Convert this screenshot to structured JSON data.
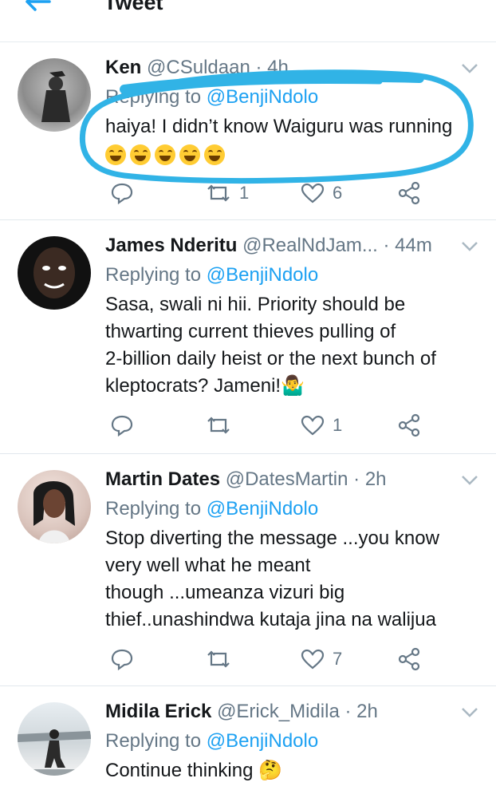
{
  "header": {
    "title": "Tweet"
  },
  "tweets": [
    {
      "name": "Ken",
      "handle": "@CSuldaan",
      "time": "4h",
      "reply_prefix": "Replying to",
      "reply_to": "@BenjiNdolo",
      "text": "haiya! I didn’t know Waiguru was running",
      "emoji": "😂😂😂😂😂",
      "retweets": "1",
      "likes": "6"
    },
    {
      "name": "James Nderitu",
      "handle": "@RealNdJam...",
      "time": "44m",
      "reply_prefix": "Replying to",
      "reply_to": "@BenjiNdolo",
      "text_lines": [
        "Sasa, swali ni hii. Priority should be",
        "thwarting current thieves pulling of",
        "2-billion daily heist or the next bunch of",
        "kleptocrats? Jameni!🤷‍♂️"
      ],
      "retweets": "",
      "likes": "1"
    },
    {
      "name": "Martin Dates",
      "handle": "@DatesMartin",
      "time": "2h",
      "reply_prefix": "Replying to",
      "reply_to": "@BenjiNdolo",
      "text_lines": [
        "Stop diverting the message ...you know",
        "very well what he meant",
        "though ...umeanza vizuri big",
        "thief..unashindwa kutaja jina na walijua"
      ],
      "retweets": "",
      "likes": "7"
    },
    {
      "name": "Midila Erick",
      "handle": "@Erick_Midila",
      "time": "2h",
      "reply_prefix": "Replying to",
      "reply_to": "@BenjiNdolo",
      "text": "Continue thinking 🤔"
    }
  ],
  "colors": {
    "link": "#1da1f2",
    "muted": "#657786",
    "annotation": "#31b3e6"
  }
}
